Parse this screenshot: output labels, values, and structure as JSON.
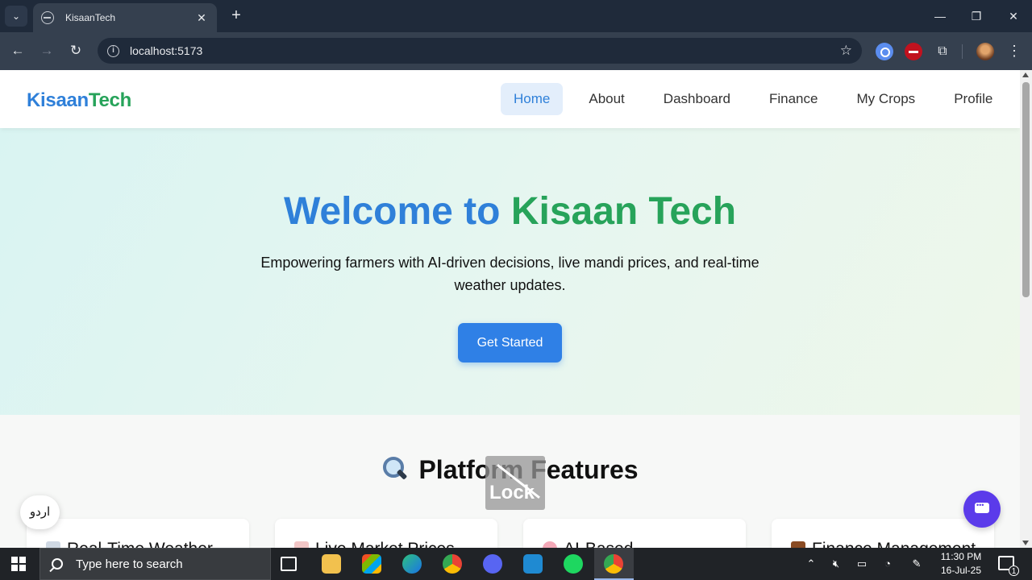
{
  "browser": {
    "tab_title": "KisaanTech",
    "new_tab_glyph": "+",
    "close_glyph": "✕",
    "url": "localhost:5173",
    "window_controls": {
      "minimize": "—",
      "restore": "❐",
      "close": "✕"
    },
    "nav_glyphs": {
      "back": "←",
      "forward": "→",
      "reload": "↻"
    },
    "icons": [
      "tab-search-icon",
      "site-favicon",
      "back-icon",
      "forward-icon",
      "reload-icon",
      "site-info-icon",
      "bookmark-star-icon",
      "extension-search-icon",
      "extension-block-icon",
      "extensions-puzzle-icon",
      "profile-avatar",
      "browser-menu-icon"
    ]
  },
  "site": {
    "logo_part1": "Kisaan",
    "logo_part2": "Tech",
    "nav": [
      {
        "label": "Home",
        "active": true
      },
      {
        "label": "About"
      },
      {
        "label": "Dashboard"
      },
      {
        "label": "Finance"
      },
      {
        "label": "My Crops"
      },
      {
        "label": "Profile"
      }
    ],
    "hero": {
      "title_part1": "Welcome to",
      "title_part2": "Kisaan Tech",
      "subtitle": "Empowering farmers with AI-driven decisions, live mandi prices, and real-time weather updates.",
      "cta": "Get Started"
    },
    "features": {
      "title": "Platform Features",
      "cards": [
        {
          "title": "Real-Time Weather"
        },
        {
          "title": "Live Market Prices"
        },
        {
          "title": "AI-Based"
        },
        {
          "title": "Finance Management"
        }
      ]
    },
    "language_toggle": "اردو",
    "lock_overlay_text": "Lock"
  },
  "colors": {
    "brand_blue": "#2f80d9",
    "brand_green": "#27a35a",
    "chat_purple": "#5b3bea"
  },
  "taskbar": {
    "search_placeholder": "Type here to search",
    "time": "11:30 PM",
    "date": "16-Jul-25",
    "notification_count": "1",
    "pinned_apps": [
      "task-view-icon",
      "file-explorer-icon",
      "store-icon",
      "edge-icon",
      "chrome-icon",
      "discord-icon",
      "vscode-icon",
      "spotify-icon",
      "chrome-profile-icon"
    ],
    "tray_icons": [
      "show-hidden-icon",
      "volume-muted-icon",
      "battery-icon",
      "network-icon",
      "pen-icon",
      "notifications-icon"
    ]
  }
}
